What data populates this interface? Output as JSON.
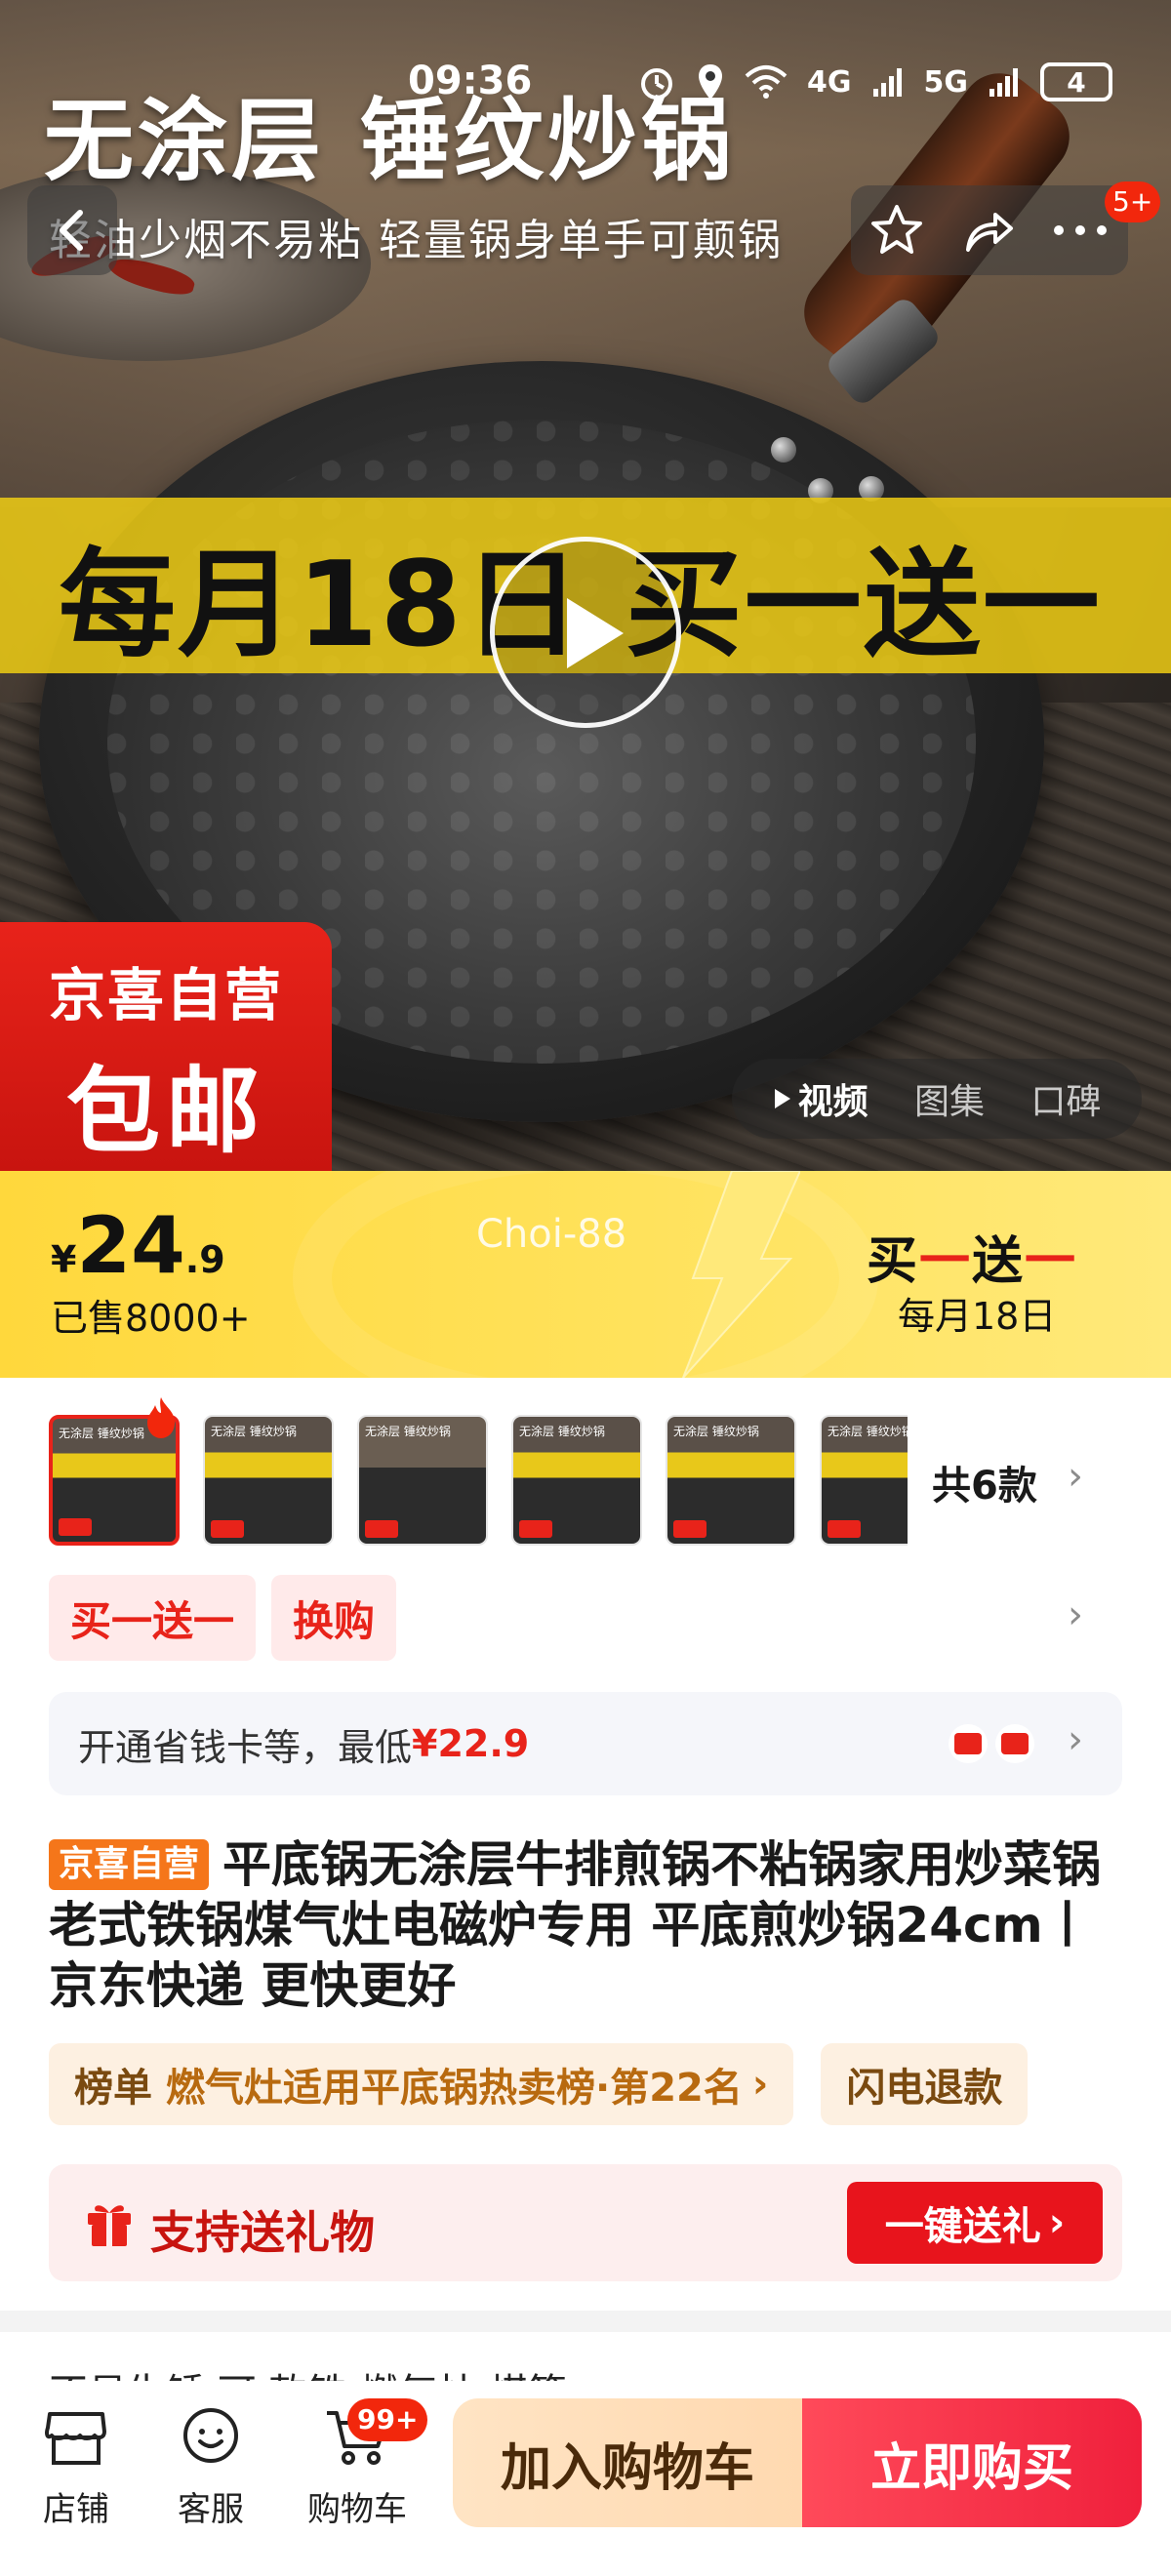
{
  "status_bar": {
    "time": "09:36",
    "network": "4G",
    "network2": "5G",
    "battery": "4"
  },
  "nav": {
    "badge": "5+"
  },
  "hero": {
    "title": "无涂层 锤纹炒锅",
    "subtitle": "轻油少烟不易粘 轻量锅身单手可颠锅",
    "promo_band": "每月18日 买一送一",
    "badge_line1": "京喜自营",
    "badge_line2": "包邮",
    "media_tabs": [
      "视频",
      "图集",
      "口碑"
    ]
  },
  "price_band": {
    "currency": "¥",
    "price_int": "24",
    "price_dec": ".9",
    "sold": "已售8000+",
    "watermark": "Choi-88",
    "bogo_a": "买",
    "bogo_b": "一",
    "bogo_c": "送",
    "bogo_d": "一",
    "bogo_date": "每月18日"
  },
  "variants": {
    "thumb_title": "无涂层 锤纹炒锅",
    "count_label": "共6款"
  },
  "promo_tags": [
    "买一送一",
    "换购"
  ],
  "card_banner": {
    "text": "开通省钱卡等，最低",
    "price": "¥22.9"
  },
  "product": {
    "store_tag": "京喜自营",
    "title": "平底锅无涂层牛排煎锅不粘锅家用炒菜锅老式铁锅煤气灶电磁炉专用 平底煎炒锅24cm丨京东快递 更快更好"
  },
  "rank": {
    "label": "榜单",
    "text": "燃气灶适用平底锅热卖榜·第22名",
    "chip2": "闪电退款"
  },
  "gift": {
    "text": "支持送礼物",
    "button": "一键送礼"
  },
  "peek_row": "不易生锈  可          款铁           燃气灶  煤等",
  "bottom_bar": {
    "store": "店铺",
    "service": "客服",
    "cart": "购物车",
    "cart_badge": "99+",
    "add_to_cart": "加入购物车",
    "buy_now": "立即购买"
  },
  "colors": {
    "accent_red": "#e8231a",
    "price_band_yellow": "#ffd83c",
    "buy_red": "#f0203c",
    "cart_peach": "#ffe4c4"
  }
}
